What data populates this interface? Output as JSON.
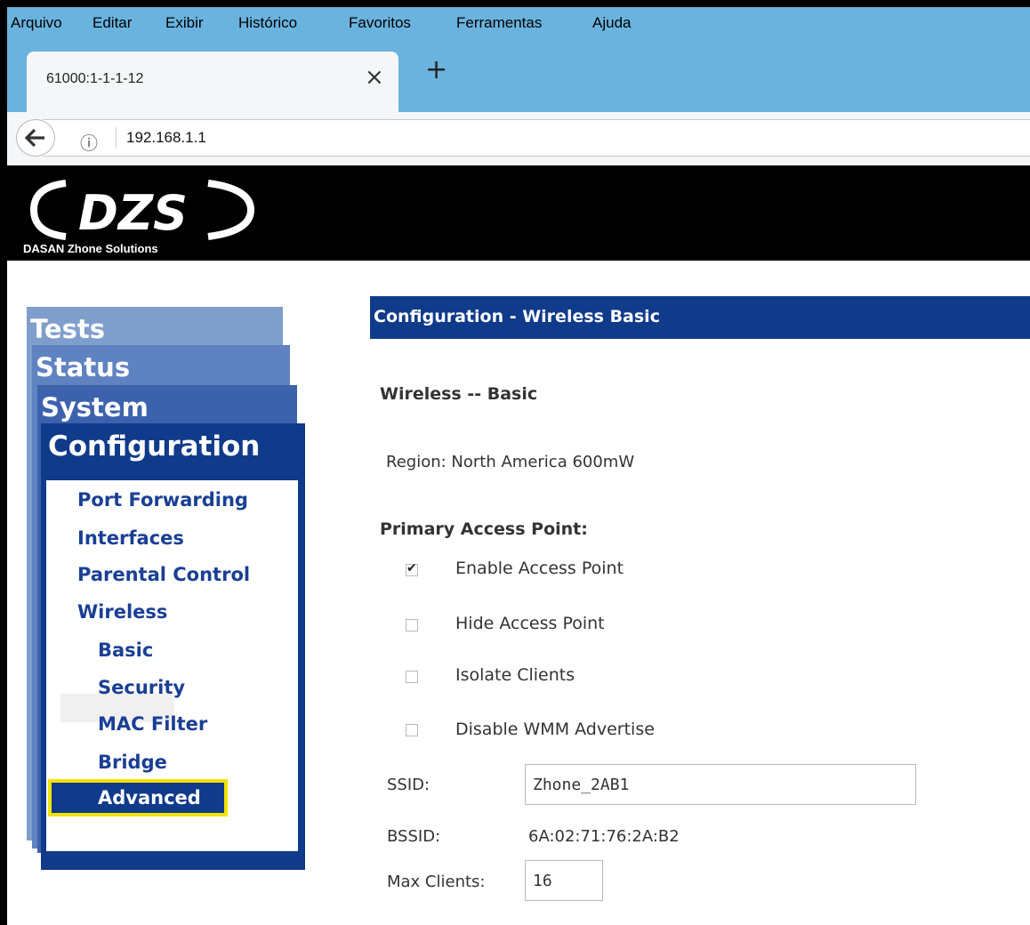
{
  "browser": {
    "menu": [
      "Arquivo",
      "Editar",
      "Exibir",
      "Histórico",
      "Favoritos",
      "Ferramentas",
      "Ajuda"
    ],
    "tab_title": "61000:1-1-1-12",
    "tab_close_glyph": "×",
    "new_tab_glyph": "+",
    "url": "192.168.1.1",
    "info_glyph": "ⓘ",
    "icons": [
      "back-arrow-icon",
      "info-icon",
      "close-icon",
      "plus-icon"
    ]
  },
  "header": {
    "logo_text": "DZS",
    "company": "DASAN Zhone Solutions"
  },
  "sidebar": {
    "tabs": [
      "Tests",
      "Status",
      "System",
      "Configuration"
    ],
    "links": [
      "Port Forwarding",
      "Interfaces",
      "Parental Control",
      "Wireless"
    ],
    "sublinks": [
      "Basic",
      "Security",
      "MAC Filter",
      "Bridge",
      "Advanced"
    ],
    "active_sublink": "Basic",
    "highlighted_sublink": "Advanced"
  },
  "main": {
    "header": "Configuration - Wireless Basic",
    "section_title": "Wireless -- Basic",
    "region": "Region:  North America  600mW",
    "ap_title": "Primary Access Point:",
    "checkboxes": [
      {
        "label": "Enable Access Point",
        "checked": true
      },
      {
        "label": "Hide Access Point",
        "checked": false
      },
      {
        "label": "Isolate Clients",
        "checked": false
      },
      {
        "label": "Disable WMM Advertise",
        "checked": false
      }
    ],
    "ssid_label": "SSID:",
    "ssid_value": "Zhone_2AB1",
    "bssid_label": "BSSID:",
    "bssid_value": "6A:02:71:76:2A:B2",
    "max_clients_label": "Max Clients:",
    "max_clients_value": "16"
  },
  "colors": {
    "chrome_blue": "#6ab3df",
    "nav_dark_blue": "#103a8a",
    "highlight_yellow": "#f3e300"
  }
}
